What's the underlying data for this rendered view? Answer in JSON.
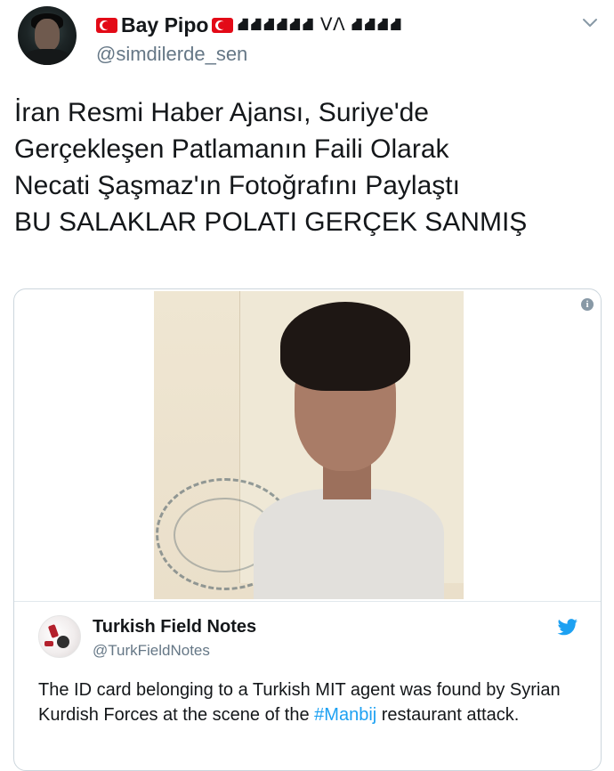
{
  "author": {
    "display_name": "Bay Pipo",
    "name_suffix": "⛘⛘⛘⛘⛘⛘ ᐯᐱ ⛘⛘⛘⛘",
    "handle": "@simdilerde_sen",
    "flag_icon": "turkey-flag-icon"
  },
  "tweet": {
    "text": "İran Resmi Haber Ajansı, Suriye'de\nGerçekleşen Patlamanın Faili Olarak\nNecati Şaşmaz'ın Fotoğrafını Paylaştı\nBU SALAKLAR POLATI GERÇEK SANMIŞ"
  },
  "embed": {
    "info_icon": "i",
    "quoted": {
      "name": "Turkish Field Notes",
      "handle": "@TurkFieldNotes",
      "text_before": "The ID card belonging to a Turkish MIT agent was found by Syrian Kurdish Forces at the scene of the ",
      "hashtag": "#Manbij",
      "text_after": " restaurant attack."
    }
  },
  "colors": {
    "link": "#1da1f2",
    "muted": "#657786",
    "flag_red": "#e30a17"
  }
}
